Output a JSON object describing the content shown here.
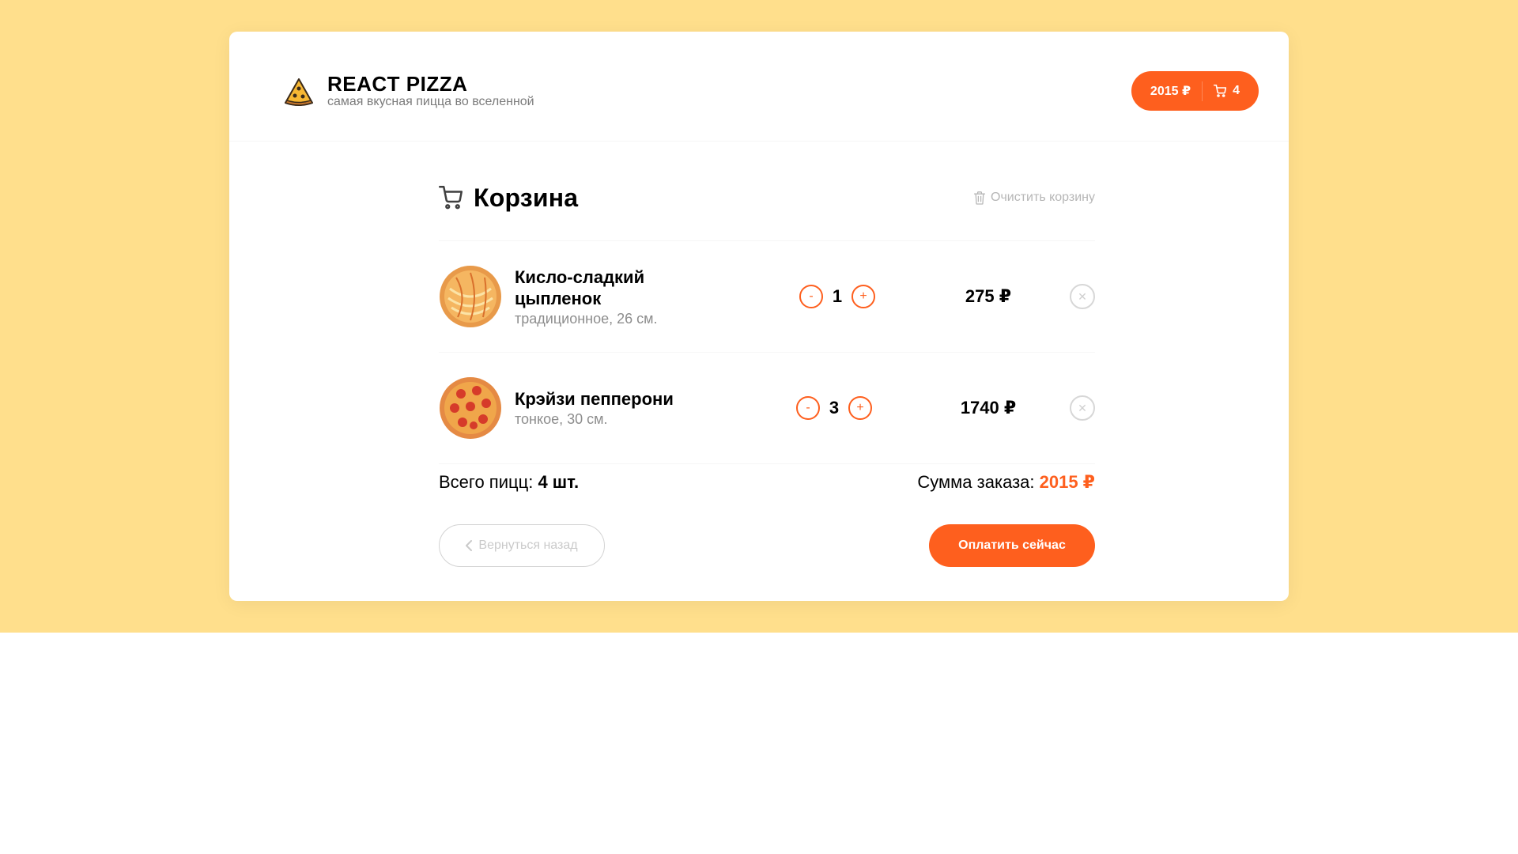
{
  "header": {
    "title": "REACT PIZZA",
    "subtitle": "самая вкусная пицца во вселенной",
    "cart_price": "2015 ₽",
    "cart_count": "4"
  },
  "cart": {
    "title": "Корзина",
    "clear_label": "Очистить корзину",
    "items": [
      {
        "name": "Кисло-сладкий цыпленок",
        "desc": "традиционное, 26 см.",
        "count": "1",
        "price": "275 ₽",
        "minus": "-",
        "plus": "+"
      },
      {
        "name": "Крэйзи пепперони",
        "desc": "тонкое, 30 см.",
        "count": "3",
        "price": "1740 ₽",
        "minus": "-",
        "plus": "+"
      }
    ],
    "total_label": "Всего пицц: ",
    "total_value": "4 шт.",
    "sum_label": "Сумма заказа: ",
    "sum_value": "2015 ₽",
    "back_label": "Вернуться назад",
    "pay_label": "Оплатить сейчас"
  },
  "colors": {
    "accent": "#fe5f1e",
    "background": "#ffdf8c"
  },
  "icons": [
    "pizza-logo-icon",
    "cart-icon",
    "trash-icon",
    "close-icon",
    "chevron-left-icon"
  ]
}
